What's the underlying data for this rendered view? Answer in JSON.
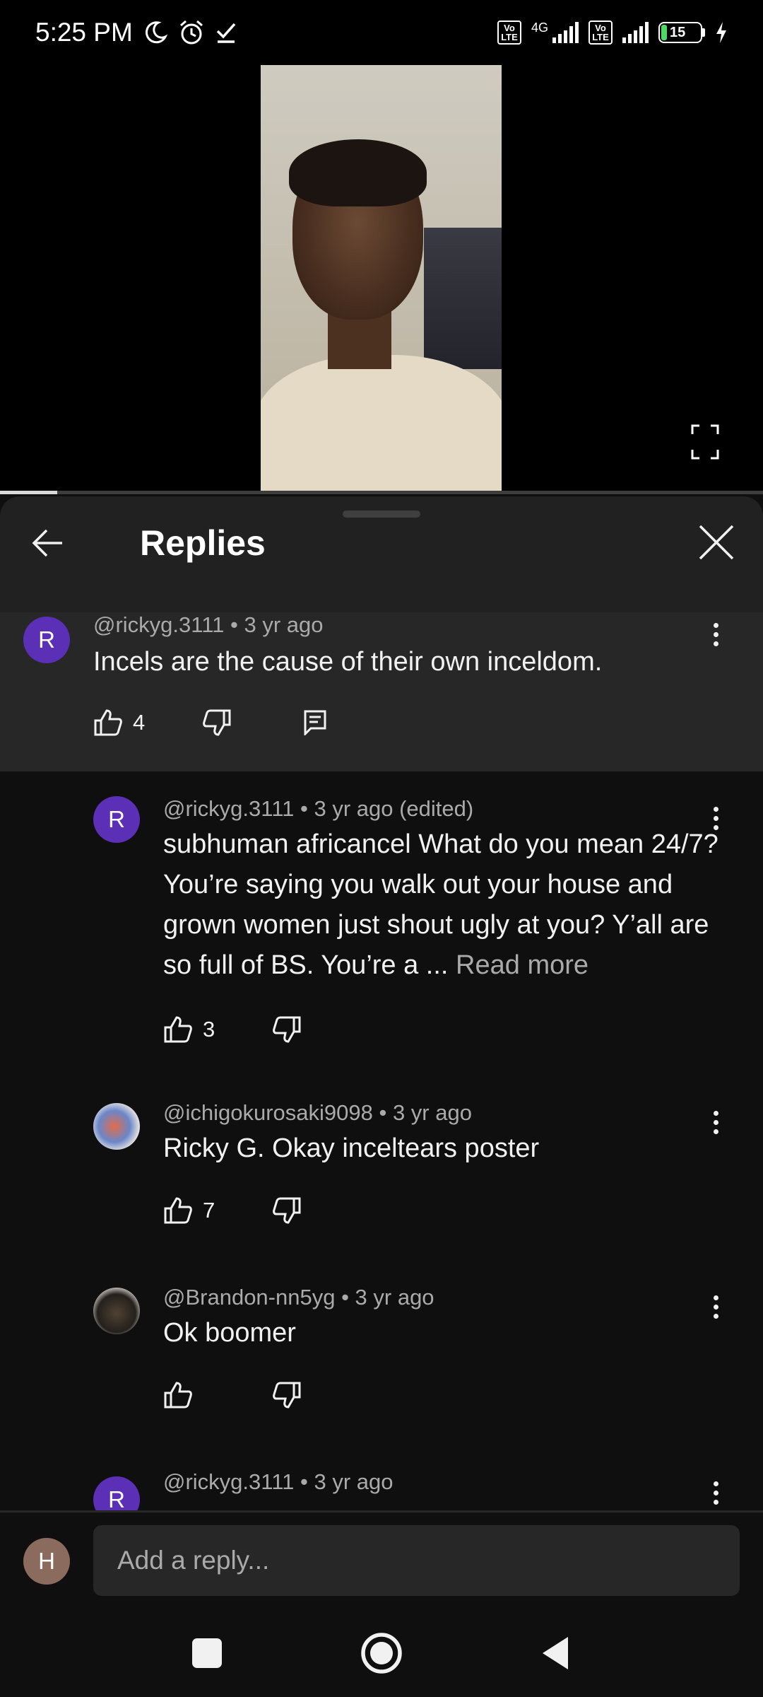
{
  "status_bar": {
    "time": "5:25 PM",
    "icons": [
      "moon-icon",
      "alarm-icon",
      "check-icon"
    ],
    "volte_label": "Vo LTE",
    "network_label": "4G",
    "battery_level": "15",
    "battery_percent": 15,
    "charging": true
  },
  "video": {
    "progress_fraction": 0.075
  },
  "sheet": {
    "title": "Replies"
  },
  "parent_comment": {
    "avatar_letter": "R",
    "meta": "@rickyg.3111 • 3 yr ago",
    "text": "Incels are the cause of their own inceldom.",
    "likes": "4"
  },
  "replies": [
    {
      "avatar_letter": "R",
      "meta": "@rickyg.3111 • 3 yr ago (edited)",
      "text": "subhuman africancel What do you mean 24/7? You’re saying you walk out your house and grown women just shout ugly at you? Y’all are so full of BS. You’re a ...",
      "read_more": "Read more",
      "likes": "3"
    },
    {
      "avatar_letter": "",
      "meta": "@ichigokurosaki9098 • 3 yr ago",
      "text": "Ricky G. Okay inceltears poster",
      "likes": "7"
    },
    {
      "avatar_letter": "",
      "meta": "@Brandon-nn5yg • 3 yr ago",
      "text": "Ok boomer",
      "likes": ""
    },
    {
      "avatar_letter": "R",
      "meta": "@rickyg.3111 • 3 yr ago",
      "text": "",
      "likes": ""
    }
  ],
  "reply_bar": {
    "avatar_letter": "H",
    "placeholder": "Add a reply..."
  },
  "colors": {
    "avatar_purple": "#5b2fb6",
    "sheet_bg": "#212121",
    "list_bg": "#0f0f0f",
    "highlight_bg": "#272727",
    "meta_gray": "#aaaaaa"
  }
}
